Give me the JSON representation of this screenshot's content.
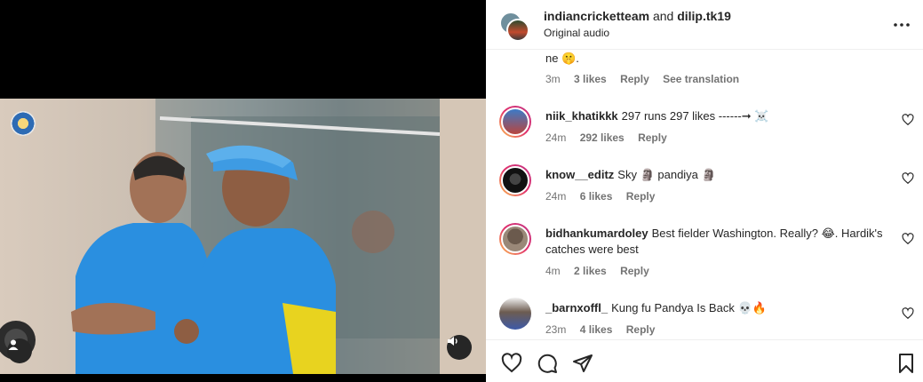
{
  "header": {
    "account_primary": "indiancricketteam",
    "conjunction": "and",
    "account_secondary": "dilip.tk19",
    "subtitle": "Original audio"
  },
  "partial_comment": {
    "text_tail": "ne 🤫.",
    "time": "3m",
    "likes": "3 likes",
    "reply": "Reply",
    "translate": "See translation"
  },
  "comments": [
    {
      "username": "niik_khatikkk",
      "text": "297 runs 297 likes ------➞ ☠️",
      "time": "24m",
      "likes": "292 likes",
      "reply": "Reply"
    },
    {
      "username": "know__editz",
      "text": "Sky 🗿 pandiya 🗿",
      "time": "24m",
      "likes": "6 likes",
      "reply": "Reply"
    },
    {
      "username": "bidhankumardoley",
      "text": "Best fielder Washington. Really? 😂. Hardik's catches were best",
      "time": "4m",
      "likes": "2 likes",
      "reply": "Reply"
    },
    {
      "username": "_barnxoffl_",
      "text": "Kung fu Pandya Is Back 💀🔥",
      "time": "23m",
      "likes": "4 likes",
      "reply": "Reply"
    }
  ],
  "icons": {
    "like": "heart-icon",
    "comment": "comment-icon",
    "share": "send-icon",
    "save": "bookmark-icon",
    "more": "more-options-icon",
    "audio": "speaker-icon",
    "tags": "user-tag-icon"
  },
  "colors": {
    "text": "#262626",
    "muted": "#737373",
    "jersey": "#2a8fe0"
  }
}
